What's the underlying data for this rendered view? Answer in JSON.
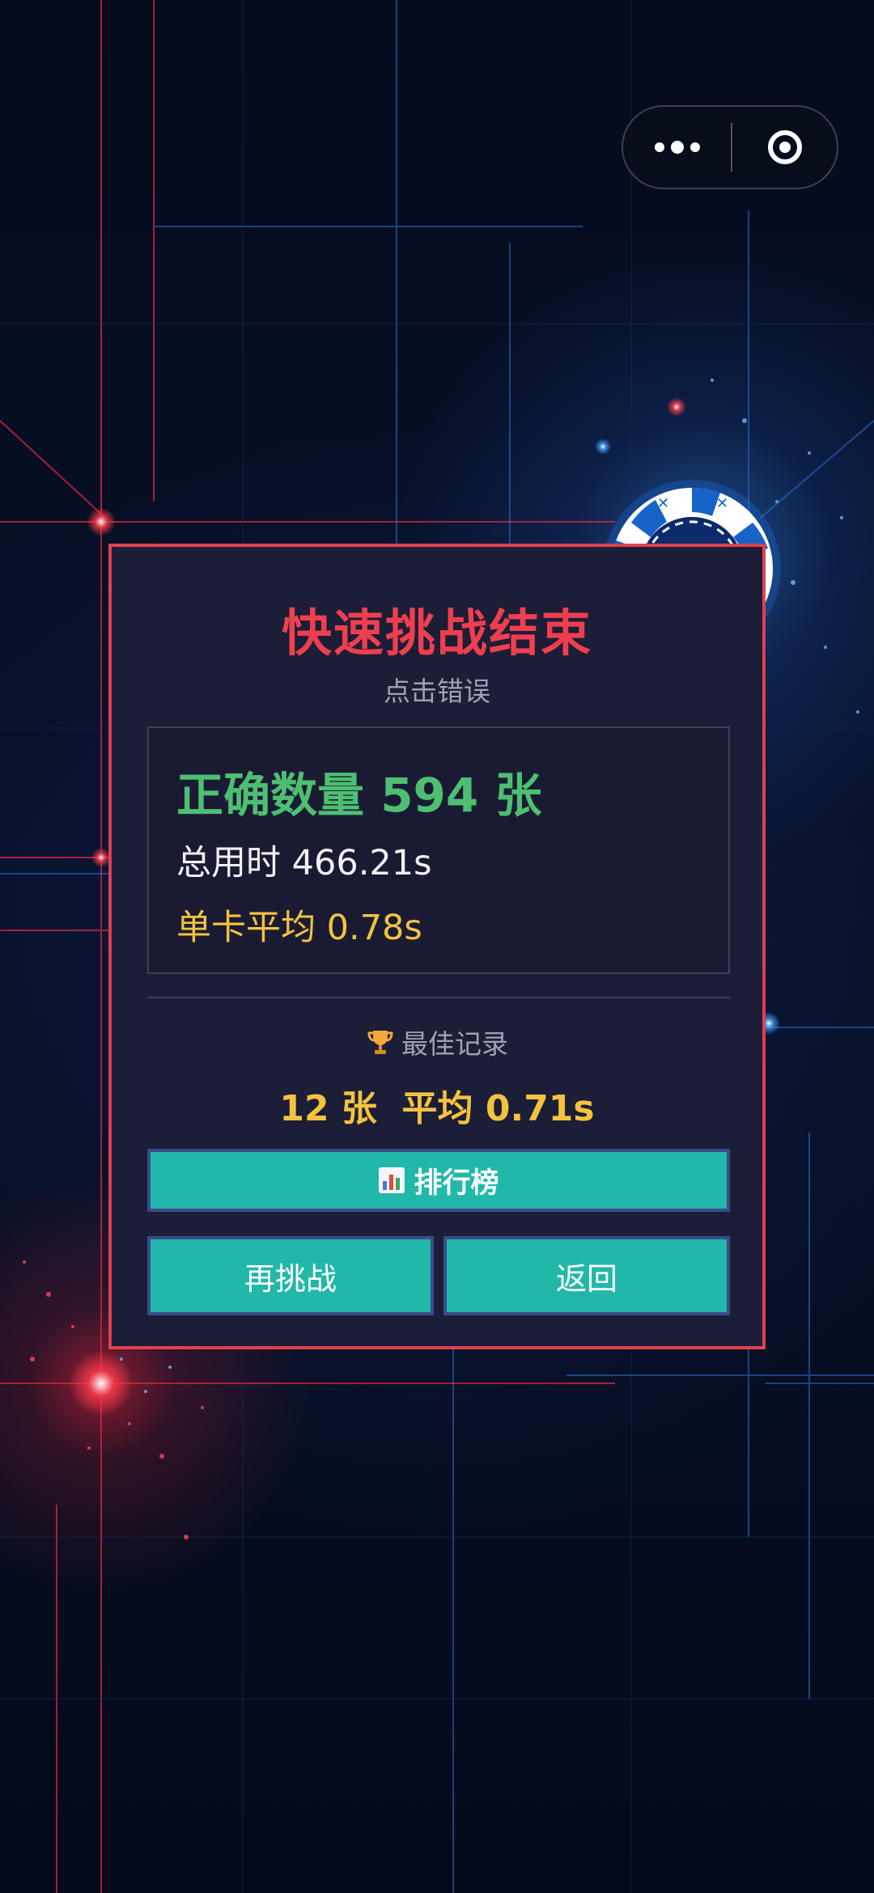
{
  "icons": {
    "more": "more-dots-icon",
    "close": "close-ring-icon",
    "trophy": "trophy-icon",
    "leaderboard": "bar-chart-icon",
    "decoration": "poker-chip-icon"
  },
  "colors": {
    "title": "#ee3f4f",
    "dialog_border": "#e0404e",
    "correct": "#4ebf72",
    "highlight": "#f3c33f",
    "button": "#22b8a9",
    "button_border": "#3b4a8a"
  },
  "dialog": {
    "title": "快速挑战结束",
    "error_link": "点击错误",
    "stats": {
      "correct_count": "正确数量 594 张",
      "total_time": "总用时 466.21s",
      "avg_time": "单卡平均 0.78s"
    },
    "best_record": {
      "label": "最佳记录",
      "value": "12 张  平均 0.71s"
    },
    "buttons": {
      "leaderboard": "排行榜",
      "retry": "再挑战",
      "back": "返回"
    }
  }
}
